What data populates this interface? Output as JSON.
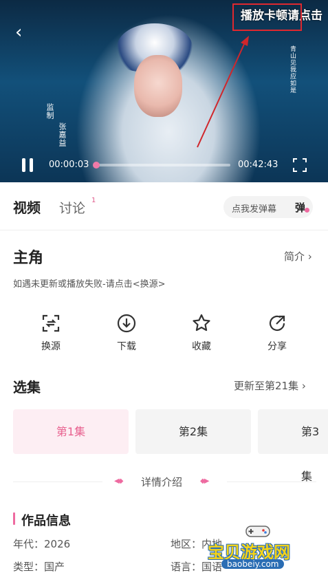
{
  "player": {
    "danmaku_hint": "播放卡顿请点击",
    "time_current": "00:00:03",
    "time_total": "00:42:43",
    "progress": 0.001,
    "overlay_text_left_1": "监制",
    "overlay_text_left_2": "张嘉益",
    "overlay_text_right": "青山见我应如是"
  },
  "tabs": {
    "video": "视频",
    "discuss": "讨论",
    "discuss_count": "1",
    "danmaku_input": "点我发弹幕",
    "danmaku_toggle": "弹"
  },
  "show": {
    "title": "主角",
    "intro_link": "简介 ›",
    "notice": "如遇未更新或播放失败-请点击<换源>"
  },
  "actions": [
    {
      "label": "换源",
      "icon": "switch-source-icon"
    },
    {
      "label": "下载",
      "icon": "download-icon"
    },
    {
      "label": "收藏",
      "icon": "star-icon"
    },
    {
      "label": "分享",
      "icon": "share-icon"
    }
  ],
  "episodes": {
    "title": "选集",
    "update": "更新至第21集 ›",
    "items": [
      "第1集",
      "第2集",
      "第3集"
    ]
  },
  "details": {
    "label": "详情介绍",
    "info_title": "作品信息",
    "year_label": "年代：2026",
    "region_label": "地区：内地",
    "type_label": "类型：国产",
    "lang_label": "语言：国语"
  },
  "watermark": {
    "text": "宝贝游戏网",
    "url": "baobeiy.com"
  },
  "colors": {
    "accent": "#ee6aa0",
    "highlight": "#e0282e"
  }
}
